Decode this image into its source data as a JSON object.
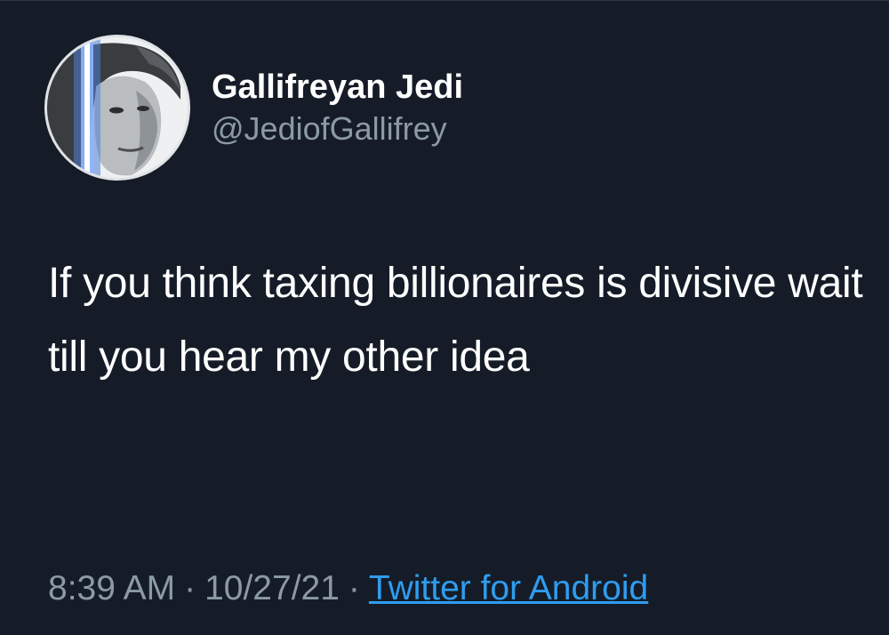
{
  "profile": {
    "display_name": "Gallifreyan Jedi",
    "handle": "@JediofGallifrey",
    "avatar_icon": "profile-photo-with-lightsaber"
  },
  "tweet": {
    "text": "If you think taxing billionaires is divisive wait till you hear my other idea"
  },
  "meta": {
    "time": "8:39 AM",
    "separator": "·",
    "date": "10/27/21",
    "source": "Twitter for Android"
  },
  "colors": {
    "background": "#151c28",
    "text_primary": "#ffffff",
    "text_secondary": "#8c99a6",
    "link": "#2e9df0"
  }
}
